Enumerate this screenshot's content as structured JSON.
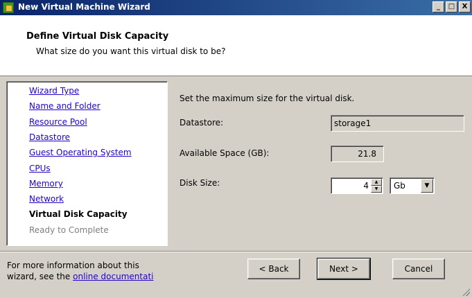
{
  "window": {
    "title": "New Virtual Machine Wizard",
    "controls": [
      "_",
      "□",
      "X"
    ]
  },
  "header": {
    "title": "Define Virtual Disk Capacity",
    "subtitle": "What size do you want this virtual disk to be?"
  },
  "steps": [
    {
      "label": "Wizard Type",
      "state": "link"
    },
    {
      "label": "Name and Folder",
      "state": "link"
    },
    {
      "label": "Resource Pool",
      "state": "link"
    },
    {
      "label": "Datastore",
      "state": "link"
    },
    {
      "label": "Guest Operating System",
      "state": "link"
    },
    {
      "label": "CPUs",
      "state": "link"
    },
    {
      "label": "Memory",
      "state": "link"
    },
    {
      "label": "Network",
      "state": "link"
    },
    {
      "label": "Virtual Disk Capacity",
      "state": "current"
    },
    {
      "label": "Ready to Complete",
      "state": "future"
    }
  ],
  "main": {
    "intro": "Set the maximum size for the virtual disk.",
    "datastore_label": "Datastore:",
    "datastore_value": "storage1",
    "available_label": "Available Space (GB):",
    "available_value": "21.8",
    "disk_size_label": "Disk Size:",
    "disk_size_value": "4",
    "unit_value": "Gb"
  },
  "footer": {
    "info_line1": "For more information about this",
    "info_line2_prefix": "wizard, see the",
    "info_link": "online documentati",
    "back_label": "< Back",
    "next_label": "Next >",
    "cancel_label": "Cancel"
  }
}
